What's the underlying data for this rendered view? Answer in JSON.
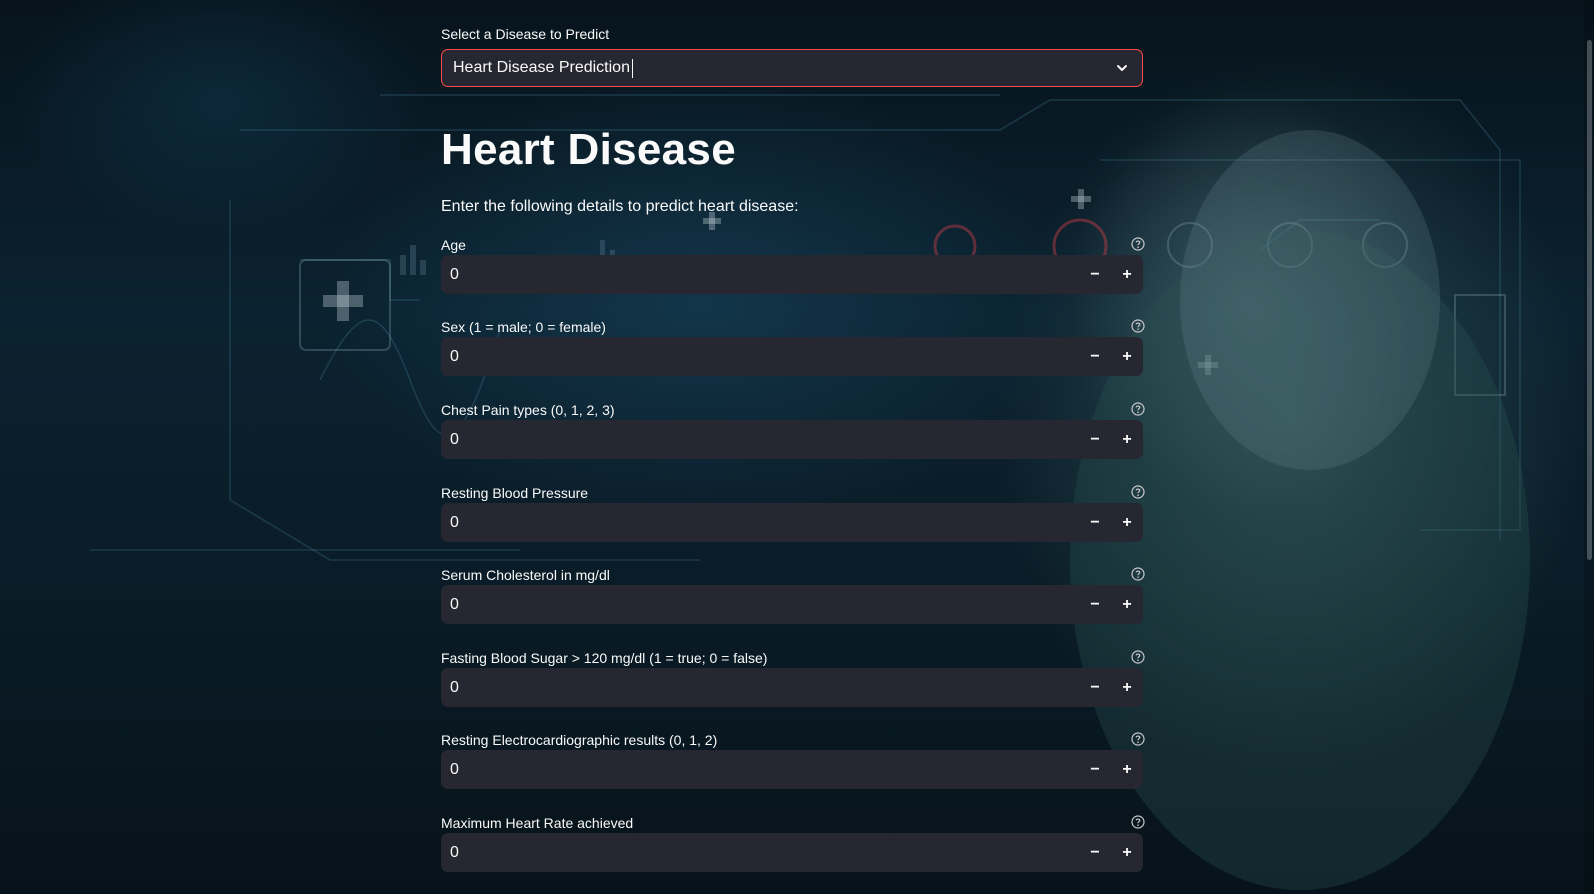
{
  "select": {
    "label": "Select a Disease to Predict",
    "value": "Heart Disease Prediction"
  },
  "page": {
    "title": "Heart Disease",
    "subtitle": "Enter the following details to predict heart disease:"
  },
  "fields": [
    {
      "label": "Age",
      "value": "0"
    },
    {
      "label": "Sex (1 = male; 0 = female)",
      "value": "0"
    },
    {
      "label": "Chest Pain types (0, 1, 2, 3)",
      "value": "0"
    },
    {
      "label": "Resting Blood Pressure",
      "value": "0"
    },
    {
      "label": "Serum Cholesterol in mg/dl",
      "value": "0"
    },
    {
      "label": "Fasting Blood Sugar > 120 mg/dl (1 = true; 0 = false)",
      "value": "0"
    },
    {
      "label": "Resting Electrocardiographic results (0, 1, 2)",
      "value": "0"
    },
    {
      "label": "Maximum Heart Rate achieved",
      "value": "0"
    }
  ],
  "stepper": {
    "decrement": "−",
    "increment": "+"
  },
  "colors": {
    "accent": "#ff4b4b",
    "input_bg": "#262730",
    "text": "#fafafa"
  },
  "icons": {
    "select_chevron": "chevron-down-icon",
    "field_help": "help-circle-icon"
  }
}
